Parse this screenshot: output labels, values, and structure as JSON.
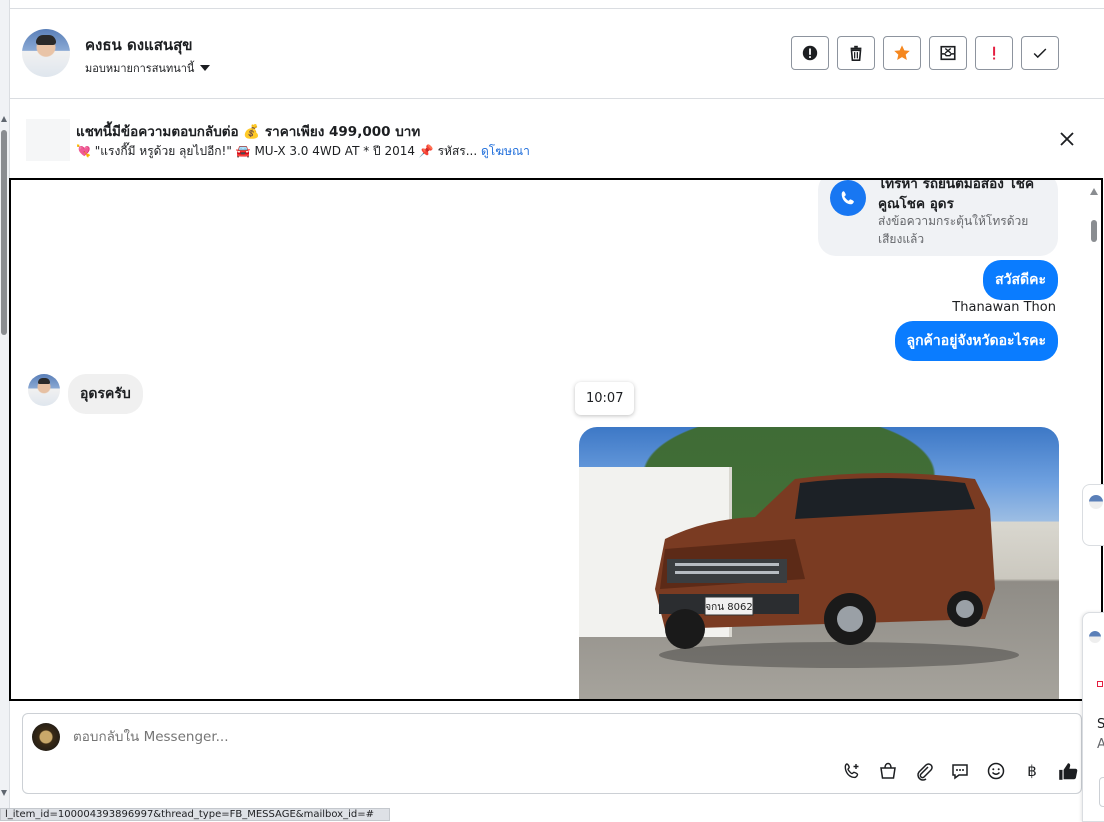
{
  "contact": {
    "name": "คงธน ดงแสนสุข",
    "assign_label": "มอบหมายการสนทนานี้"
  },
  "header_actions": [
    {
      "name": "alert-icon"
    },
    {
      "name": "trash-icon"
    },
    {
      "name": "star-icon",
      "color": "#f5871f"
    },
    {
      "name": "archive-icon"
    },
    {
      "name": "exclamation-icon",
      "color": "#e41e3f"
    },
    {
      "name": "check-icon"
    }
  ],
  "ad_banner": {
    "title": "แชทนี้มีข้อความตอบกลับต่อ 💰 ราคาเพียง 499,000 บาท",
    "subtitle": "💘 \"แรงกี๊มี หรูด้วย ลุยไปอีก!\" 🚘 MU-X 3.0 4WD AT * ปี 2014 📌 รหัสร...",
    "link": "ดูโฆษณา"
  },
  "thread": {
    "call_card": {
      "title": "โทรหา รถยนต์มือสอง โชคคูณโชค อุดร",
      "subtitle": "ส่งข้อความกระตุ้นให้โทรด้วยเสียงแล้ว"
    },
    "messages_out_1": "สวัสดีคะ",
    "sender_name": "Thanawan Thon",
    "messages_out_2": "ลูกค้าอยู่จังหวัดอะไรคะ",
    "message_in": "อุดรครับ",
    "timestamp": "10:07",
    "photo_plate": "จกน 8062"
  },
  "composer": {
    "placeholder": "ตอบกลับใน Messenger...",
    "tools": [
      "phone-plus-icon",
      "shopping-bag-icon",
      "paperclip-icon",
      "chat-bubble-icon",
      "smile-icon",
      "baht-icon",
      "thumbs-up-icon"
    ],
    "baht_symbol": "฿"
  },
  "status_url": "l_item_id=100004393896997&thread_type=FB_MESSAGE&mailbox_id=#",
  "side_peek": {
    "line1": "S",
    "line2": "A"
  }
}
